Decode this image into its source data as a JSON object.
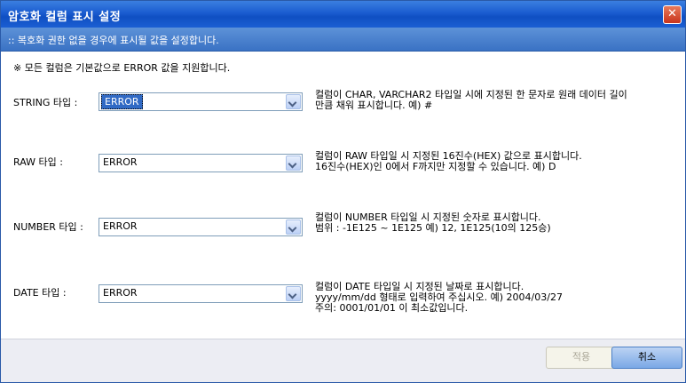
{
  "window": {
    "title": "암호화 컬럼 표시 설정",
    "close_glyph": "✕"
  },
  "subheader": ":: 복호화 권한 없을 경우에 표시될 값을 설정합니다.",
  "notice": "※ 모든 컬럼은 기본값으로 ERROR 값을 지원합니다.",
  "rows": [
    {
      "label": "STRING 타입 :",
      "value": "ERROR",
      "desc": [
        "컬럼이 CHAR, VARCHAR2 타입일 시에 지정된 한 문자로 원래 데이터 길이",
        "만큼 채워 표시합니다.  예) #"
      ]
    },
    {
      "label": "RAW 타입 :",
      "value": "ERROR",
      "desc": [
        "컬럼이 RAW 타입일 시 지정된 16진수(HEX) 값으로 표시합니다.",
        "16진수(HEX)인 0에서 F까지만 지정할 수 있습니다. 예) D"
      ]
    },
    {
      "label": "NUMBER 타입 :",
      "value": "ERROR",
      "desc": [
        "컬럼이 NUMBER 타입일 시 지정된 숫자로 표시합니다.",
        "범위 :  -1E125  ~  1E125     예) 12, 1E125(10의 125승)"
      ]
    },
    {
      "label": "DATE 타입 :",
      "value": "ERROR",
      "desc": [
        "컬럼이 DATE 타입일 시 지정된 날짜로 표시합니다.",
        "yyyy/mm/dd 형태로 입력하여 주십시오. 예) 2004/03/27",
        "주의: 0001/01/01 이 최소값입니다."
      ]
    }
  ],
  "buttons": {
    "apply": "적용",
    "cancel": "취소"
  },
  "colors": {
    "titlebar": "#1a5cd0",
    "subheader": "#4a82ce",
    "selection": "#316ac5"
  }
}
